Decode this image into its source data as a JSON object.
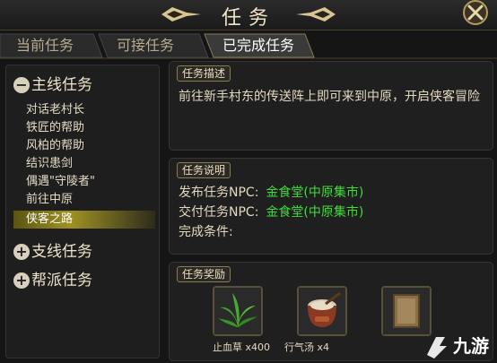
{
  "window": {
    "title": "任务"
  },
  "tabs": [
    {
      "label": "当前任务"
    },
    {
      "label": "可接任务"
    },
    {
      "label": "已完成任务"
    }
  ],
  "sidebar": {
    "groups": [
      {
        "label": "主线任务",
        "toggle": "−",
        "items": [
          {
            "label": "对话老村长"
          },
          {
            "label": "铁匠的帮助"
          },
          {
            "label": "风柏的帮助"
          },
          {
            "label": "结识患剑"
          },
          {
            "label": "偶遇\"守陵者\""
          },
          {
            "label": "前往中原"
          },
          {
            "label": "侠客之路"
          }
        ]
      },
      {
        "label": "支线任务",
        "toggle": "+"
      },
      {
        "label": "帮派任务",
        "toggle": "+"
      }
    ]
  },
  "description": {
    "header": "任务描述",
    "text": "前往新手村东的传送阵上即可来到中原，开启侠客冒险"
  },
  "info": {
    "header": "任务说明",
    "issue_label": "发布任务NPC:",
    "issue_value": "金食堂(中原集市)",
    "submit_label": "交付任务NPC:",
    "submit_value": "金食堂(中原集市)",
    "condition_label": "完成条件:"
  },
  "rewards": {
    "header": "任务奖励",
    "items": [
      {
        "label": "止血草 x400",
        "icon": "herb-icon"
      },
      {
        "label": "行气汤 x4",
        "icon": "soup-bowl-icon"
      },
      {
        "label": "",
        "icon": "scroll-icon"
      }
    ]
  },
  "watermark": {
    "text": "九游"
  },
  "colors": {
    "npc_value": "#3fdc3a",
    "selected": "#9f9222"
  }
}
